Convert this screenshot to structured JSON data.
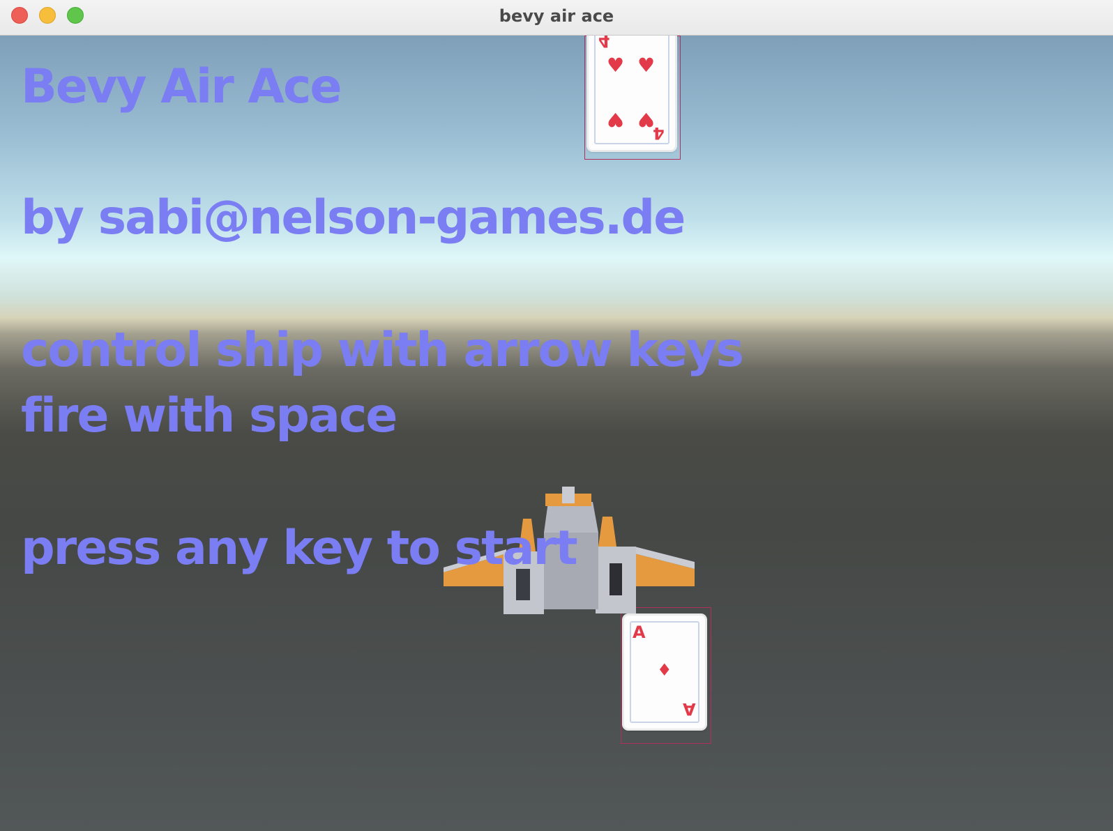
{
  "window": {
    "title": "bevy air ace"
  },
  "game": {
    "title_line": "Bevy Air Ace",
    "author_line": "by sabi@nelson-games.de",
    "controls_line_1": "control ship with arrow keys",
    "controls_line_2": "fire with space",
    "start_prompt": "press any key to start",
    "text_color": "#7b7df2"
  },
  "cards": [
    {
      "rank": "4",
      "suit": "hearts",
      "suit_glyph": "♥",
      "color": "#e33a4a"
    },
    {
      "rank": "A",
      "suit": "diamonds",
      "suit_glyph": "♦",
      "color": "#e33a4a"
    }
  ],
  "ship": {
    "name": "player-ship",
    "colors": {
      "body": "#b6b9c2",
      "wing": "#e59a3f",
      "dark": "#3a3d44"
    }
  }
}
